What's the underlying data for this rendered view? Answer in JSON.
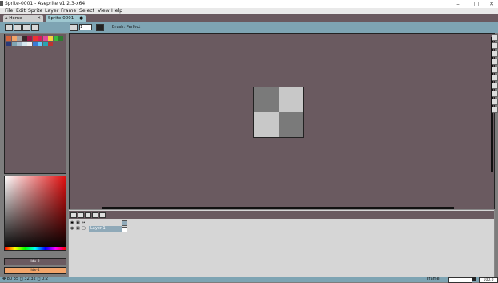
{
  "window": {
    "title": "Sprite-0001 - Aseprite v1.2.3-x64",
    "minimize_label": "–",
    "maximize_label": "□",
    "close_label": "✕"
  },
  "menu": {
    "items": [
      "File",
      "Edit",
      "Sprite",
      "Layer",
      "Frame",
      "Select",
      "View",
      "Help"
    ]
  },
  "tabs": [
    {
      "label": "Home",
      "close": "✕"
    },
    {
      "label": "Sprite-0001",
      "close": "●"
    }
  ],
  "toolbar": {
    "brush_size": "1",
    "brush_label": "Brush: Perfect"
  },
  "palette": {
    "colors": [
      "#d4623a",
      "#f2a56a",
      "#a0a0a0",
      "#3a2a2a",
      "#a0194a",
      "#e33",
      "#d81f5a",
      "#e04a9a",
      "#f7d040",
      "#3bbb3b",
      "#2e7d32",
      "#2a3a7a",
      "#7ea4b3",
      "#a9bfd0",
      "#d6e8f0",
      "#f0f0f0",
      "#3a7bd5",
      "#66ccff",
      "#2aa4b3",
      "#b33"
    ]
  },
  "colors": {
    "fg_label": "Idx-2",
    "bg_label": "Idx-4",
    "fg_hex": "#6a5a60",
    "bg_hex": "#f2a56a"
  },
  "layers": [
    {
      "name": "Layer 1"
    }
  ],
  "status": {
    "coords": "✥ 80 35   ◻ 32 32   ◻ 0:2",
    "frame_label": "Frame:",
    "zoom": "100.0"
  }
}
